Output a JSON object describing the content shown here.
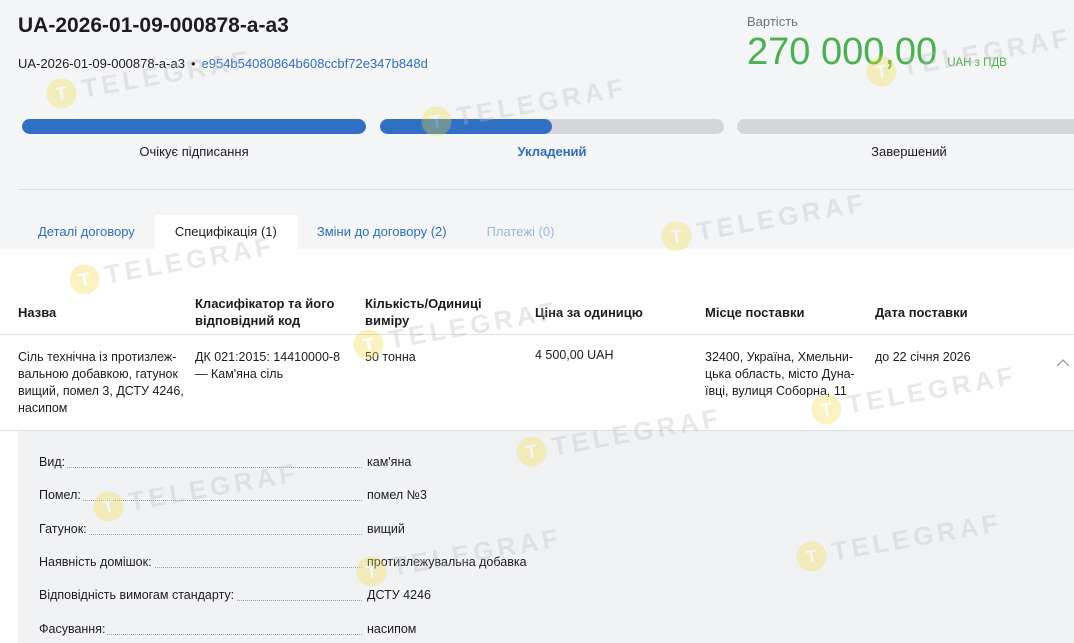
{
  "contract": {
    "id": "UA-2026-01-09-000878-a-a3",
    "sub_id": "UA-2026-01-09-000878-a-a3",
    "separator": "•",
    "hash": "e954b54080864b608ccbf72e347b848d"
  },
  "price": {
    "label": "Вартість",
    "value": "270 000,00",
    "unit": "UAH з ПДВ"
  },
  "steps": [
    {
      "label": "Очікує підписання",
      "progress": 1.0,
      "active": false
    },
    {
      "label": "Укладений",
      "progress": 0.5,
      "active": true
    },
    {
      "label": "Завершений",
      "progress": 0.0,
      "active": false
    }
  ],
  "tabs": [
    {
      "label": "Деталі договору"
    },
    {
      "label": "Специфікація (1)"
    },
    {
      "label": "Зміни до договору (2)"
    },
    {
      "label": "Платежі (0)"
    }
  ],
  "table": {
    "headers": [
      "Назва",
      "Класифікатор та його відповідний код",
      "Кількість/Одиниці виміру",
      "Ціна за одиницю",
      "Місце поставки",
      "Дата поставки"
    ],
    "row": {
      "name": "Сіль технічна із протизлеж-вальною добавкою, гатунок вищий, помел 3, ДСТУ 4246, насипом",
      "classifier": "ДК 021:2015: 14410000-8 — Кам'яна сіль",
      "quantity": "50 тонна",
      "unit_price": "4 500,00 UAH",
      "place": "32400, Україна, Хмельни-цька область, місто Дуна-ївці, вулиця Соборна, 11",
      "date": "до 22 січня 2026"
    }
  },
  "details": [
    {
      "label": "Вид:",
      "value": "кам'яна"
    },
    {
      "label": "Помел:",
      "value": "помел №3"
    },
    {
      "label": "Гатунок:",
      "value": "вищий"
    },
    {
      "label": "Наявність домішок:",
      "value": "протизлежувальна добавка"
    },
    {
      "label": "Відповідність вимогам стандарту:",
      "value": "ДСТУ 4246"
    },
    {
      "label": "Фасування:",
      "value": "насипом"
    }
  ],
  "watermark": {
    "text": "TELEGRAF",
    "letter": "T",
    "color": "#f2dc45"
  }
}
